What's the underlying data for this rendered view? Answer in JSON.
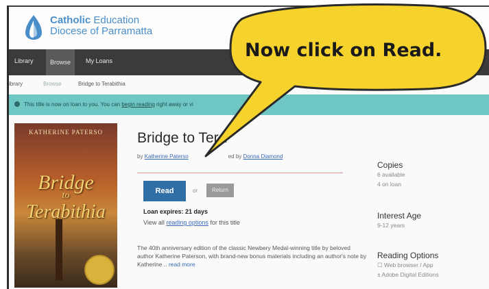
{
  "header": {
    "brand_bold": "Catholic",
    "brand_rest": " Education",
    "brand_line2": "Diocese of Parramatta"
  },
  "nav": {
    "items": [
      {
        "label": "Library"
      },
      {
        "label": "Browse"
      },
      {
        "label": "My Loans"
      }
    ]
  },
  "breadcrumb": {
    "items": [
      "ibrary",
      "Browse",
      "Bridge to Terabithia"
    ]
  },
  "alert": {
    "text_before": "This title is now on loan to you. You can ",
    "link": "begin reading",
    "text_after": " right away or vi"
  },
  "cover": {
    "author": "KATHERINE PATERSO",
    "title_1": "Bridge",
    "title_2": "to",
    "title_3": "Terabithia"
  },
  "book": {
    "title": "Bridge to Tera",
    "by_prefix": "by ",
    "author": "Katherine Paterso",
    "illustrator_prefix": "ed by ",
    "illustrator": "Donna Diamond"
  },
  "actions": {
    "read_label": "Read",
    "or_label": "or",
    "return_label": "Return",
    "loan_expires": "Loan expires: 21 days",
    "view_prefix": "View all ",
    "view_link": "reading options",
    "view_suffix": " for this title"
  },
  "description": {
    "text": "The 40th anniversary edition of the classic Newbery Medal-winning title by beloved author Katherine Paterson, with brand-new bonus materials including an author's note by Katherine .. ",
    "more": "read more"
  },
  "sidebar": {
    "copies_heading": "Copies",
    "copies_available": "6 available",
    "copies_on_loan": "4 on loan",
    "interest_heading": "Interest Age",
    "interest_value": "9-12 years",
    "reading_heading": "Reading Options",
    "reading_option_1": "☐ Web browser / App",
    "reading_option_2": "± Adobe Digital Editions"
  },
  "callout": {
    "text": "Now click on Read."
  },
  "colors": {
    "brand_blue": "#4a8ec9",
    "nav_bg": "#3b3b3b",
    "alert_bg": "#6fc7c4",
    "read_button": "#2f6fa5",
    "callout_fill": "#f5d22c"
  }
}
